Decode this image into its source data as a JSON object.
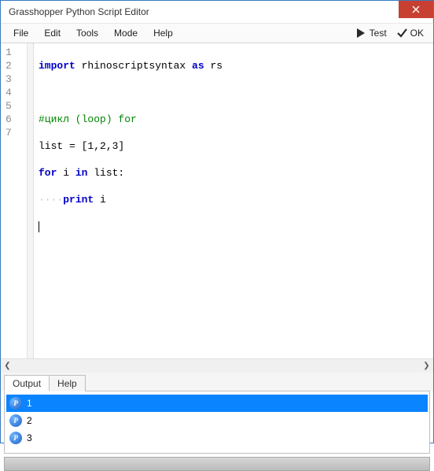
{
  "window": {
    "title": "Grasshopper Python Script Editor"
  },
  "menu": {
    "items": [
      "File",
      "Edit",
      "Tools",
      "Mode",
      "Help"
    ],
    "test": "Test",
    "ok": "OK"
  },
  "code": {
    "line_numbers": [
      "1",
      "2",
      "3",
      "4",
      "5",
      "6",
      "7"
    ],
    "tokens": {
      "l1_kw1": "import",
      "l1_id": " rhinoscriptsyntax ",
      "l1_kw2": "as",
      "l1_rs": " rs",
      "l3_cmt": "#цикл (loop) for",
      "l4_a": "list = [1,2,3]",
      "l5_kw1": "for",
      "l5_mid": " i ",
      "l5_kw2": "in",
      "l5_end": " list:",
      "l6_ws": "····",
      "l6_kw": "print",
      "l6_end": " i"
    }
  },
  "bottom_tabs": {
    "output": "Output",
    "help": "Help"
  },
  "output": {
    "rows": [
      {
        "value": "1",
        "selected": true
      },
      {
        "value": "2",
        "selected": false
      },
      {
        "value": "3",
        "selected": false
      }
    ]
  }
}
